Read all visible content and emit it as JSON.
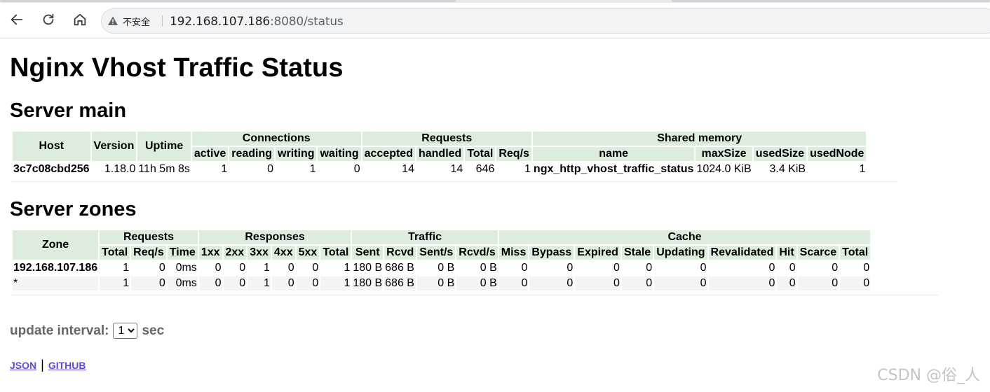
{
  "browser": {
    "security_label": "不安全",
    "url_host": "192.168.107.186",
    "url_rest": ":8080/status"
  },
  "page": {
    "title": "Nginx Vhost Traffic Status",
    "server_main": {
      "heading": "Server main",
      "group_headers": {
        "connections": "Connections",
        "requests": "Requests",
        "shared_memory": "Shared memory"
      },
      "columns": [
        "Host",
        "Version",
        "Uptime",
        "active",
        "reading",
        "writing",
        "waiting",
        "accepted",
        "handled",
        "Total",
        "Req/s",
        "name",
        "maxSize",
        "usedSize",
        "usedNode"
      ],
      "row": [
        "3c7c08cbd256",
        "1.18.0",
        "11h 5m 8s",
        "1",
        "0",
        "1",
        "0",
        "14",
        "14",
        "646",
        "1",
        "ngx_http_vhost_traffic_status",
        "1024.0 KiB",
        "3.4 KiB",
        "1"
      ]
    },
    "server_zones": {
      "heading": "Server zones",
      "group_headers": {
        "requests": "Requests",
        "responses": "Responses",
        "traffic": "Traffic",
        "cache": "Cache"
      },
      "columns": [
        "Zone",
        "Total",
        "Req/s",
        "Time",
        "1xx",
        "2xx",
        "3xx",
        "4xx",
        "5xx",
        "Total",
        "Sent",
        "Rcvd",
        "Sent/s",
        "Rcvd/s",
        "Miss",
        "Bypass",
        "Expired",
        "Stale",
        "Updating",
        "Revalidated",
        "Hit",
        "Scarce",
        "Total"
      ],
      "rows": [
        [
          "192.168.107.186",
          "1",
          "0",
          "0ms",
          "0",
          "0",
          "1",
          "0",
          "0",
          "1",
          "180 B",
          "686 B",
          "0 B",
          "0 B",
          "0",
          "0",
          "0",
          "0",
          "0",
          "0",
          "0",
          "0",
          "0"
        ],
        [
          "*",
          "1",
          "0",
          "0ms",
          "0",
          "0",
          "1",
          "0",
          "0",
          "1",
          "180 B",
          "686 B",
          "0 B",
          "0 B",
          "0",
          "0",
          "0",
          "0",
          "0",
          "0",
          "0",
          "0",
          "0"
        ]
      ]
    },
    "update_interval": {
      "label": "update interval:",
      "selected": "1",
      "unit": "sec"
    },
    "links": {
      "json": "JSON",
      "github": "GITHUB"
    }
  },
  "watermark": "CSDN @俗_人"
}
